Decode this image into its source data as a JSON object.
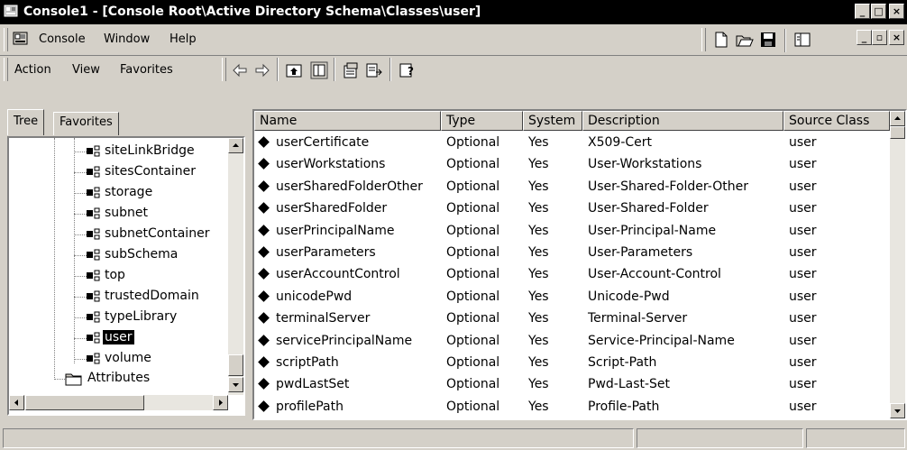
{
  "window": {
    "title": "Console1 - [Console Root\\Active Directory Schema\\Classes\\user]",
    "minimize_label": "_",
    "restore_label": "□",
    "close_label": "×"
  },
  "menubar": {
    "console": "Console",
    "window": "Window",
    "help": "Help",
    "child_min": "_",
    "child_restore": "▫",
    "child_close": "×"
  },
  "toolbar": {
    "action": "Action",
    "view": "View",
    "favorites": "Favorites",
    "back_icon": "back-arrow-icon",
    "forward_icon": "forward-arrow-icon"
  },
  "tree": {
    "tabs": [
      "Tree",
      "Favorites"
    ],
    "items": [
      {
        "label": "siteLinkBridge"
      },
      {
        "label": "sitesContainer"
      },
      {
        "label": "storage"
      },
      {
        "label": "subnet"
      },
      {
        "label": "subnetContainer"
      },
      {
        "label": "subSchema"
      },
      {
        "label": "top"
      },
      {
        "label": "trustedDomain"
      },
      {
        "label": "typeLibrary"
      },
      {
        "label": "user",
        "selected": true
      },
      {
        "label": "volume"
      }
    ],
    "folder": "Attributes"
  },
  "list": {
    "columns": [
      "Name",
      "Type",
      "System",
      "Description",
      "Source Class"
    ],
    "rows": [
      {
        "name": "userCertificate",
        "type": "Optional",
        "system": "Yes",
        "description": "X509-Cert",
        "source": "user"
      },
      {
        "name": "userWorkstations",
        "type": "Optional",
        "system": "Yes",
        "description": "User-Workstations",
        "source": "user"
      },
      {
        "name": "userSharedFolderOther",
        "type": "Optional",
        "system": "Yes",
        "description": "User-Shared-Folder-Other",
        "source": "user"
      },
      {
        "name": "userSharedFolder",
        "type": "Optional",
        "system": "Yes",
        "description": "User-Shared-Folder",
        "source": "user"
      },
      {
        "name": "userPrincipalName",
        "type": "Optional",
        "system": "Yes",
        "description": "User-Principal-Name",
        "source": "user"
      },
      {
        "name": "userParameters",
        "type": "Optional",
        "system": "Yes",
        "description": "User-Parameters",
        "source": "user"
      },
      {
        "name": "userAccountControl",
        "type": "Optional",
        "system": "Yes",
        "description": "User-Account-Control",
        "source": "user"
      },
      {
        "name": "unicodePwd",
        "type": "Optional",
        "system": "Yes",
        "description": "Unicode-Pwd",
        "source": "user"
      },
      {
        "name": "terminalServer",
        "type": "Optional",
        "system": "Yes",
        "description": "Terminal-Server",
        "source": "user"
      },
      {
        "name": "servicePrincipalName",
        "type": "Optional",
        "system": "Yes",
        "description": "Service-Principal-Name",
        "source": "user"
      },
      {
        "name": "scriptPath",
        "type": "Optional",
        "system": "Yes",
        "description": "Script-Path",
        "source": "user"
      },
      {
        "name": "pwdLastSet",
        "type": "Optional",
        "system": "Yes",
        "description": "Pwd-Last-Set",
        "source": "user"
      },
      {
        "name": "profilePath",
        "type": "Optional",
        "system": "Yes",
        "description": "Profile-Path",
        "source": "user"
      }
    ]
  }
}
